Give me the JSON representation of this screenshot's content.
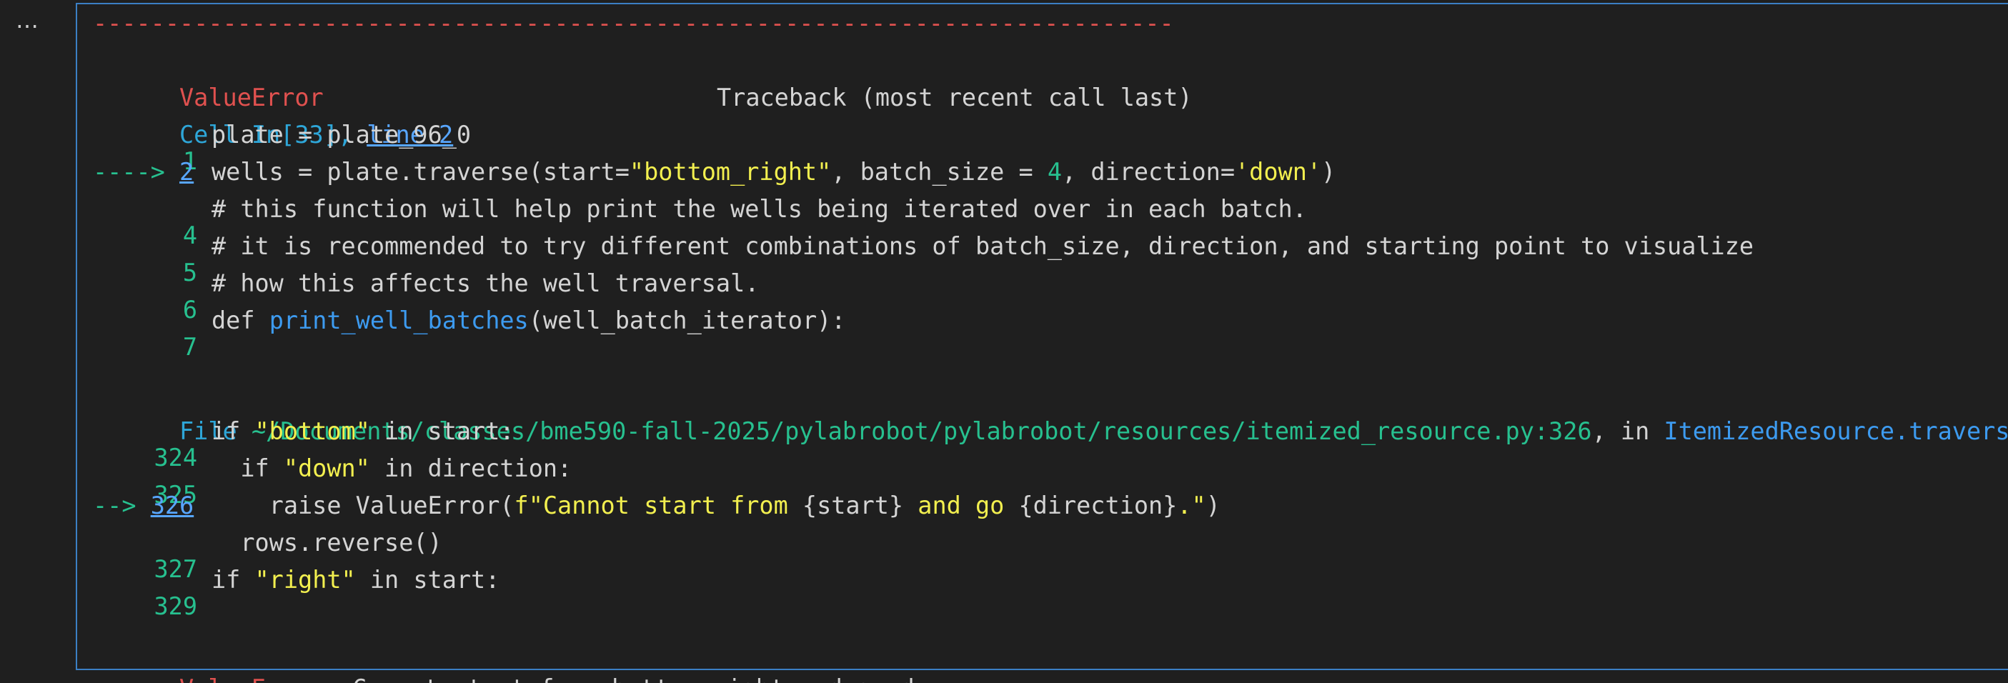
{
  "cell_toolbar": {
    "more_icon": "…"
  },
  "traceback": {
    "dashes": "---------------------------------------------------------------------------",
    "error_name": "ValueError",
    "traceback_header": "Traceback (most recent call last)",
    "cell_ref": {
      "prefix": "Cell In[33], ",
      "link": "line 2"
    },
    "cell_lines": [
      {
        "gutter": "1",
        "parts": [
          {
            "t": "plate = plate_96_0",
            "c": "gray"
          }
        ]
      },
      {
        "gutter": "2",
        "arrow": "---->",
        "link": "2",
        "parts": [
          {
            "t": "wells = plate.traverse(start=",
            "c": "gray"
          },
          {
            "t": "\"bottom_right\"",
            "c": "yellow"
          },
          {
            "t": ", batch_size = ",
            "c": "gray"
          },
          {
            "t": "4",
            "c": "green"
          },
          {
            "t": ", direction=",
            "c": "gray"
          },
          {
            "t": "'down'",
            "c": "yellow"
          },
          {
            "t": ")",
            "c": "gray"
          }
        ]
      },
      {
        "gutter": "4",
        "parts": [
          {
            "t": "# this function will help print the wells being iterated over in each batch.",
            "c": "gray"
          }
        ]
      },
      {
        "gutter": "5",
        "parts": [
          {
            "t": "# it is recommended to try different combinations of batch_size, direction, and starting point to visualize",
            "c": "gray"
          }
        ]
      },
      {
        "gutter": "6",
        "parts": [
          {
            "t": "# how this affects the well traversal.",
            "c": "gray"
          }
        ]
      },
      {
        "gutter": "7",
        "parts": [
          {
            "t": "def ",
            "c": "gray"
          },
          {
            "t": "print_well_batches",
            "c": "fn"
          },
          {
            "t": "(well_batch_iterator):",
            "c": "gray"
          }
        ]
      }
    ],
    "file_ref": {
      "prefix": "File ",
      "path": "~/Documents/classes/bme590-fall-2025/pylabrobot/pylabrobot/resources/itemized_resource.py:326",
      "middle": ", in ",
      "func": "ItemizedResource.traverse("
    },
    "file_lines": [
      {
        "gutter": "324",
        "parts": [
          {
            "t": "if ",
            "c": "gray"
          },
          {
            "t": "\"bottom\"",
            "c": "yellow"
          },
          {
            "t": " in start:",
            "c": "gray"
          }
        ]
      },
      {
        "gutter": "325",
        "parts": [
          {
            "t": "  if ",
            "c": "gray"
          },
          {
            "t": "\"down\"",
            "c": "yellow"
          },
          {
            "t": " in direction:",
            "c": "gray"
          }
        ]
      },
      {
        "gutter": "326",
        "arrow": "-->",
        "link": "326",
        "parts": [
          {
            "t": "    raise ValueError(",
            "c": "gray"
          },
          {
            "t": "f\"Cannot start from ",
            "c": "yellow"
          },
          {
            "t": "{start}",
            "c": "gray"
          },
          {
            "t": " and go ",
            "c": "yellow"
          },
          {
            "t": "{direction}",
            "c": "gray"
          },
          {
            "t": ".\"",
            "c": "yellow"
          },
          {
            "t": ")",
            "c": "gray"
          }
        ]
      },
      {
        "gutter": "327",
        "parts": [
          {
            "t": "  rows.reverse()",
            "c": "gray"
          }
        ]
      },
      {
        "gutter": "329",
        "parts": [
          {
            "t": "if ",
            "c": "gray"
          },
          {
            "t": "\"right\"",
            "c": "yellow"
          },
          {
            "t": " in start:",
            "c": "gray"
          }
        ]
      }
    ],
    "final_error": {
      "name": "ValueError",
      "message": ": Cannot start from bottom_right and go down."
    }
  },
  "colors": {
    "background": "#1f1f1f",
    "error_red": "#e0514f",
    "number_green": "#27c08f",
    "string_yellow": "#f2ef4f",
    "link_blue": "#58a6ff",
    "border_blue": "#3b7fc4"
  }
}
